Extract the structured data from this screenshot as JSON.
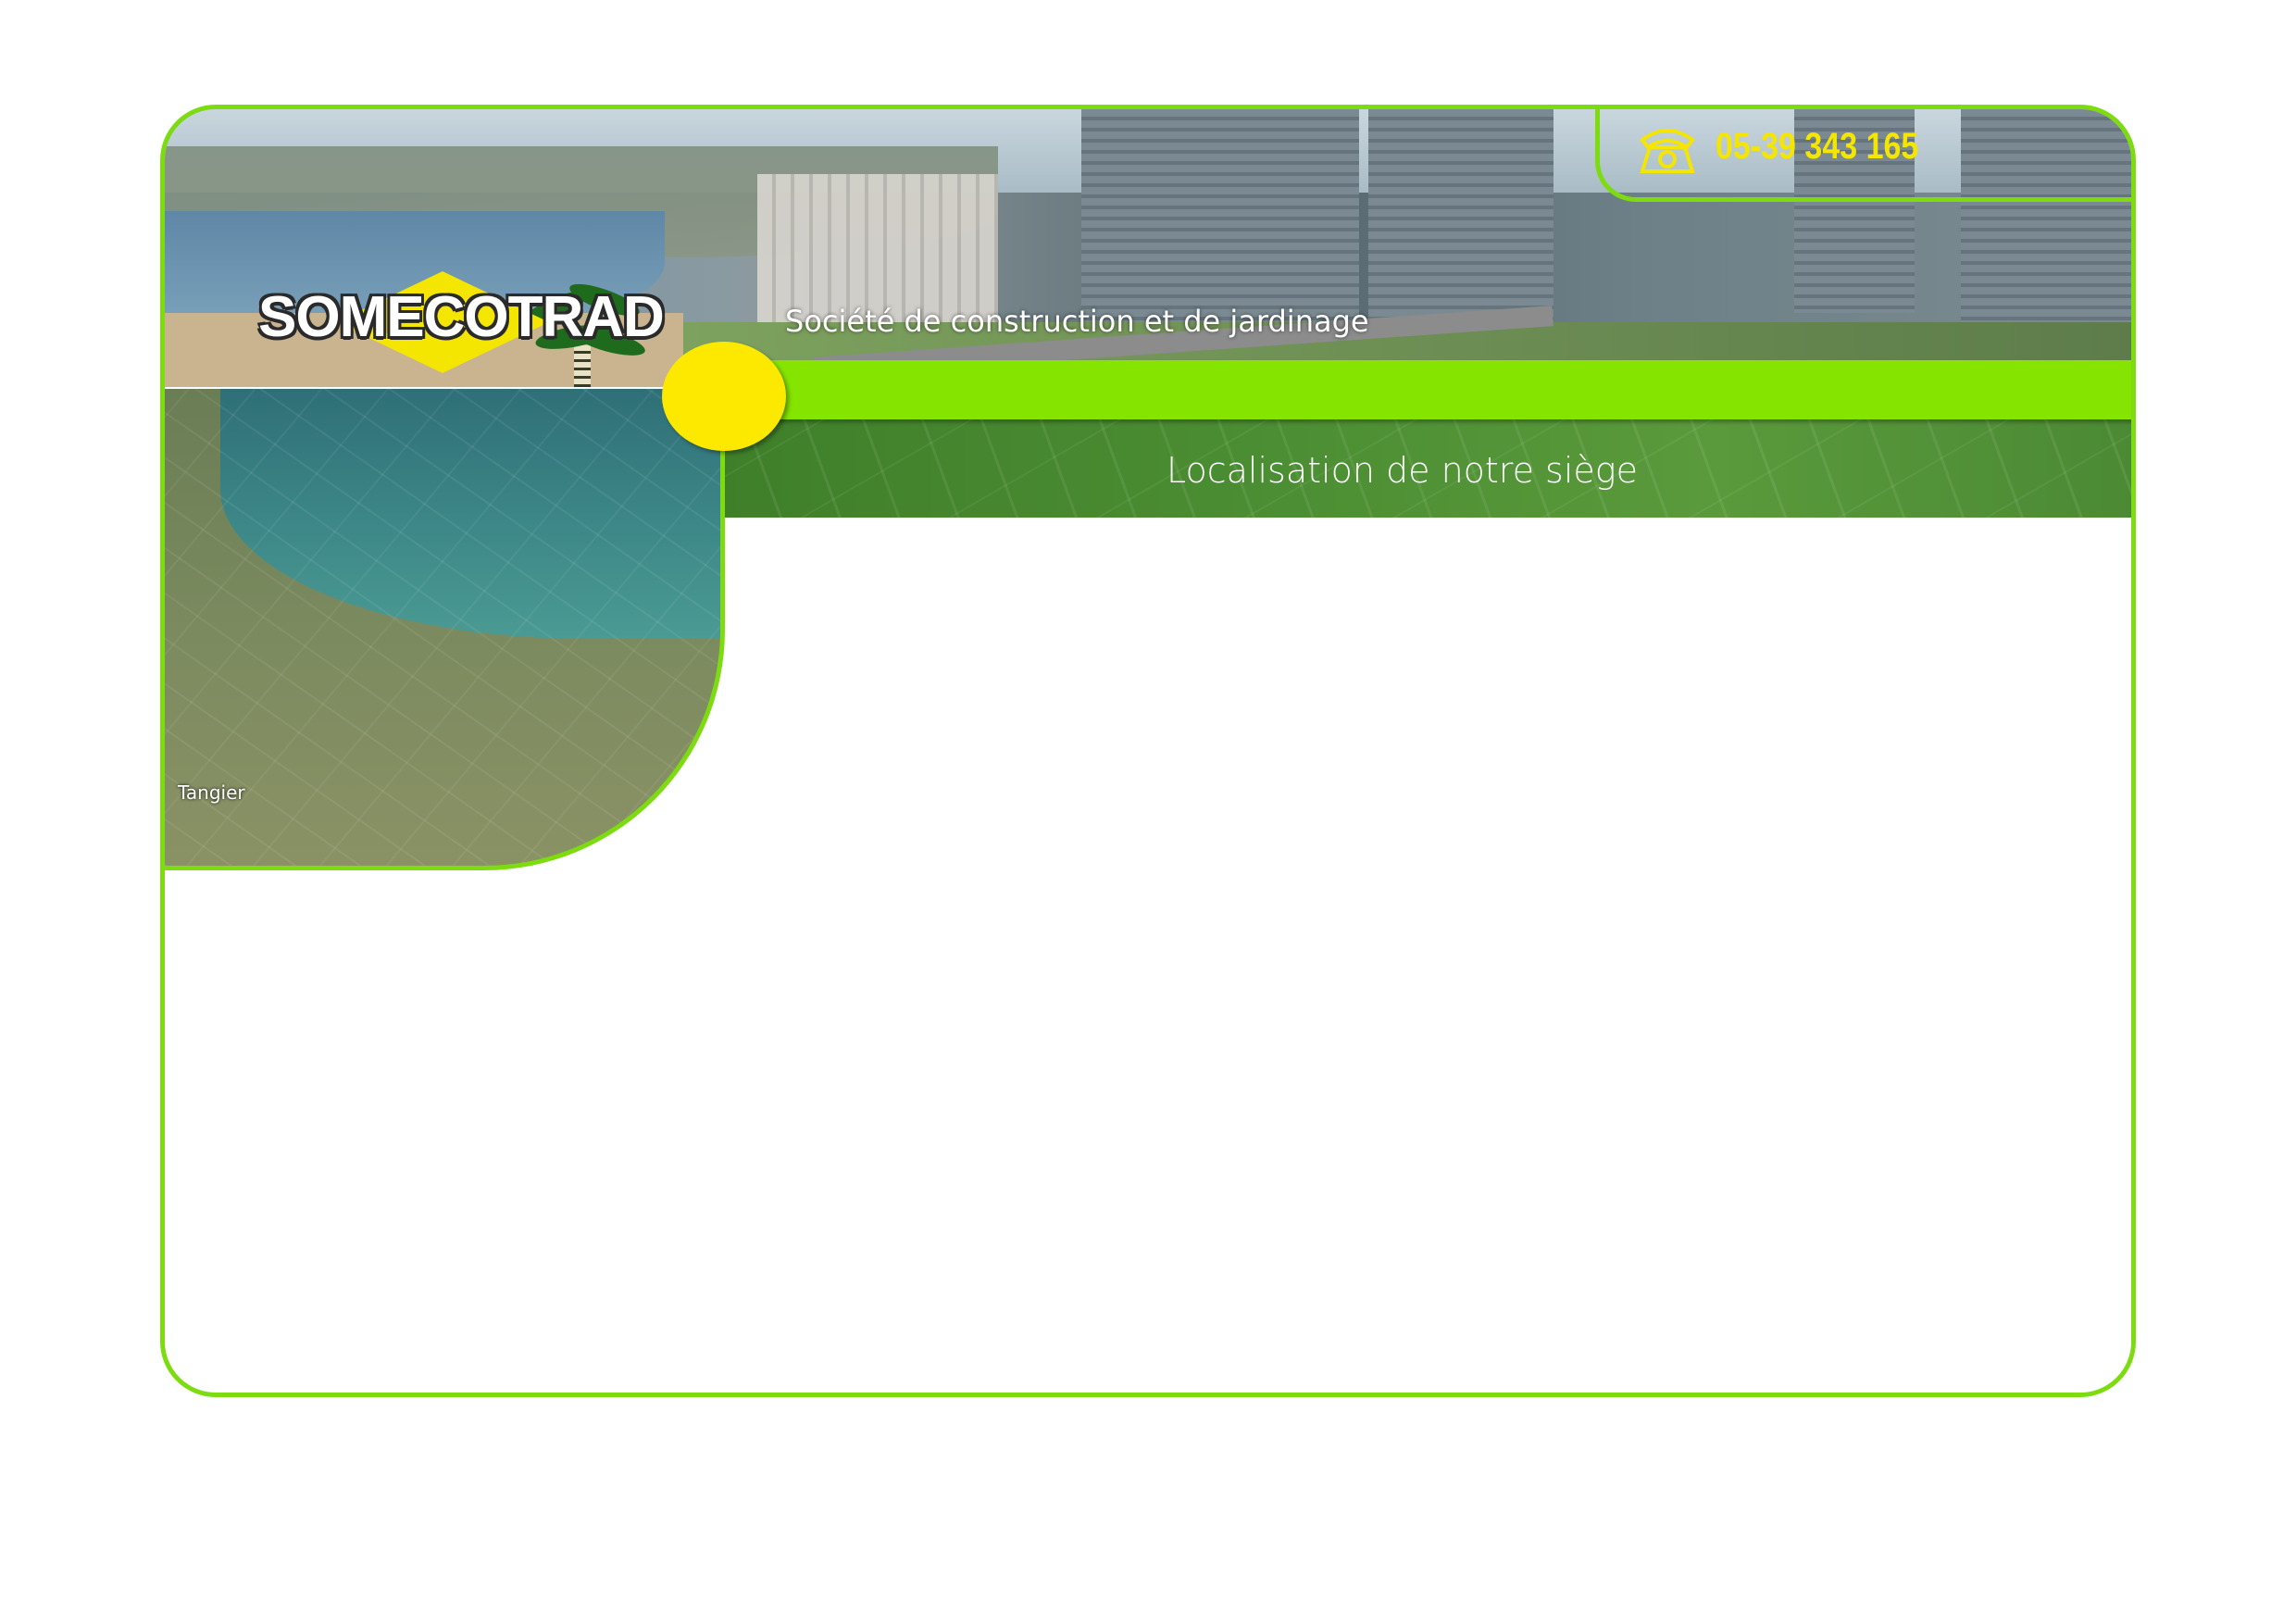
{
  "brand": {
    "logo_text": "SOMECOTRAD",
    "tagline": "Société de construction et de jardinage"
  },
  "contact": {
    "phone_number": "05-39 343 165",
    "phone_icon": "telephone-icon"
  },
  "page": {
    "title": "Localisation de notre siège"
  },
  "map": {
    "city_label": "Tangier"
  },
  "colors": {
    "frame_green": "#7ddc10",
    "bar_green": "#85e400",
    "accent_yellow": "#fde800",
    "phone_yellow": "#f4e600"
  }
}
